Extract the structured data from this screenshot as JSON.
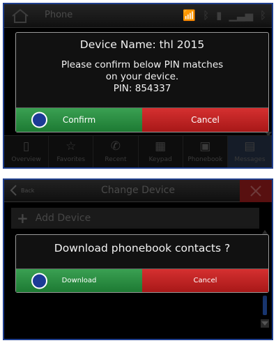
{
  "screen1": {
    "app_title": "Phone",
    "status_icons": [
      "wifi-icon",
      "bluetooth-icon",
      "battery-icon",
      "signal-icon",
      "bluetooth-icon"
    ],
    "dialog": {
      "title": "Device Name: thl 2015",
      "message_lines": [
        "Please confirm below PIN matches",
        "on your device.",
        "PIN: 854337"
      ],
      "confirm_label": "Confirm",
      "cancel_label": "Cancel"
    },
    "nav_tabs": [
      {
        "label": "Overview",
        "icon": "phone-icon"
      },
      {
        "label": "Favorites",
        "icon": "star-icon"
      },
      {
        "label": "Recent",
        "icon": "recent-calls-icon"
      },
      {
        "label": "Keypad",
        "icon": "keypad-icon"
      },
      {
        "label": "Phonebook",
        "icon": "phonebook-icon"
      },
      {
        "label": "Messages",
        "icon": "messages-icon"
      }
    ]
  },
  "screen2": {
    "back_label": "Back",
    "title": "Change Device",
    "add_device_label": "Add Device",
    "dialog": {
      "title": "Download phonebook contacts ?",
      "download_label": "Download",
      "cancel_label": "Cancel"
    }
  },
  "colors": {
    "frame_border": "#1f3f8e",
    "confirm_green": "#2a8c42",
    "cancel_red": "#c02424",
    "knob_blue": "#1c3b96",
    "close_red": "#581010"
  }
}
